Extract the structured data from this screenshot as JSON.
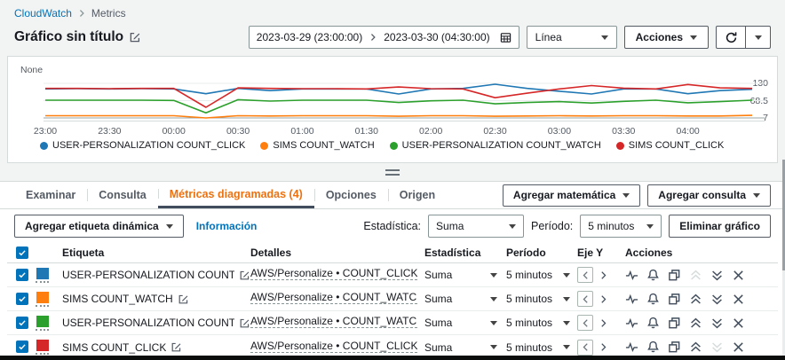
{
  "breadcrumb": {
    "items": [
      "CloudWatch",
      "Metrics"
    ]
  },
  "header": {
    "title": "Gráfico sin título",
    "date_range": {
      "start": "2023-03-29 (23:00:00)",
      "end": "2023-03-30 (04:30:00)"
    },
    "chart_type_value": "Línea",
    "actions_label": "Acciones"
  },
  "chart_data": {
    "type": "line",
    "unit_label": "None",
    "ylim": [
      7,
      130
    ],
    "y_ticks": [
      130,
      68.5,
      7
    ],
    "x": [
      "23:00",
      "23:15",
      "23:30",
      "23:45",
      "00:00",
      "00:15",
      "00:30",
      "00:45",
      "01:00",
      "01:15",
      "01:30",
      "01:45",
      "02:00",
      "02:15",
      "02:30",
      "02:45",
      "03:00",
      "03:15",
      "03:30",
      "03:45",
      "04:00",
      "04:15",
      "04:30"
    ],
    "x_tick_labels": [
      "23:00",
      "23:30",
      "00:00",
      "00:30",
      "01:00",
      "01:30",
      "02:00",
      "02:30",
      "03:00",
      "03:30",
      "04:00"
    ],
    "legend_position": "bottom",
    "grid": true,
    "series": [
      {
        "name": "USER-PERSONALIZATION COUNT_CLICK",
        "color": "#1f77b4",
        "values": [
          110,
          111,
          110,
          111,
          110,
          93,
          112,
          104,
          110,
          110,
          110,
          92,
          110,
          112,
          127,
          112,
          102,
          92,
          110,
          110,
          93,
          104,
          109
        ]
      },
      {
        "name": "SIMS COUNT_WATCH",
        "color": "#ff7f0e",
        "values": [
          15,
          15,
          15,
          15,
          15,
          7,
          15,
          14,
          15,
          15,
          15,
          13,
          15,
          15,
          13,
          14,
          15,
          14,
          15,
          15,
          14,
          14,
          16
        ]
      },
      {
        "name": "USER-PERSONALIZATION COUNT_WATCH",
        "color": "#2ca02c",
        "values": [
          70,
          70,
          70,
          70,
          69,
          25,
          72,
          67,
          70,
          70,
          70,
          62,
          68,
          70,
          57,
          62,
          65,
          60,
          66,
          70,
          61,
          65,
          70
        ]
      },
      {
        "name": "SIMS COUNT_CLICK",
        "color": "#d62728",
        "values": [
          112,
          112,
          111,
          112,
          112,
          45,
          114,
          112,
          111,
          111,
          110,
          117,
          111,
          110,
          79,
          95,
          110,
          122,
          113,
          110,
          126,
          114,
          112
        ]
      }
    ]
  },
  "tabs": [
    {
      "label": "Examinar",
      "active": false
    },
    {
      "label": "Consulta",
      "active": false
    },
    {
      "label": "Métricas diagramadas (4)",
      "active": true
    },
    {
      "label": "Opciones",
      "active": false
    },
    {
      "label": "Origen",
      "active": false
    }
  ],
  "panel": {
    "add_math_label": "Agregar matemática",
    "add_query_label": "Agregar consulta",
    "add_dynamic_label_button": "Agregar etiqueta dinámica",
    "info_link": "Información",
    "statistic_label": "Estadística:",
    "statistic_value": "Suma",
    "period_label": "Período:",
    "period_value": "5 minutos",
    "delete_graph_label": "Eliminar gráfico"
  },
  "table": {
    "columns": [
      "Etiqueta",
      "Detalles",
      "Estadística",
      "Período",
      "Eje Y",
      "Acciones"
    ],
    "rows": [
      {
        "checked": true,
        "color": "#1f77b4",
        "label": "USER-PERSONALIZATION COUNT_CLICK",
        "details": "AWS/Personalize • COUNT_CLICK • EventAttr",
        "statistic": "Suma",
        "period": "5 minutos",
        "y_axis": "left",
        "move_up_disabled": true,
        "move_down_disabled": false
      },
      {
        "checked": true,
        "color": "#ff7f0e",
        "label": "SIMS COUNT_WATCH",
        "details": "AWS/Personalize • COUNT_WATCH • EventAt",
        "statistic": "Suma",
        "period": "5 minutos",
        "y_axis": "left",
        "move_up_disabled": false,
        "move_down_disabled": false
      },
      {
        "checked": true,
        "color": "#2ca02c",
        "label": "USER-PERSONALIZATION COUNT_WA...",
        "details": "AWS/Personalize • COUNT_WATCH • EventAt",
        "statistic": "Suma",
        "period": "5 minutos",
        "y_axis": "left",
        "move_up_disabled": false,
        "move_down_disabled": false
      },
      {
        "checked": true,
        "color": "#d62728",
        "label": "SIMS COUNT_CLICK",
        "details": "AWS/Personalize • COUNT_CLICK • EventAttr",
        "statistic": "Suma",
        "period": "5 minutos",
        "y_axis": "left",
        "move_up_disabled": false,
        "move_down_disabled": true
      }
    ]
  }
}
